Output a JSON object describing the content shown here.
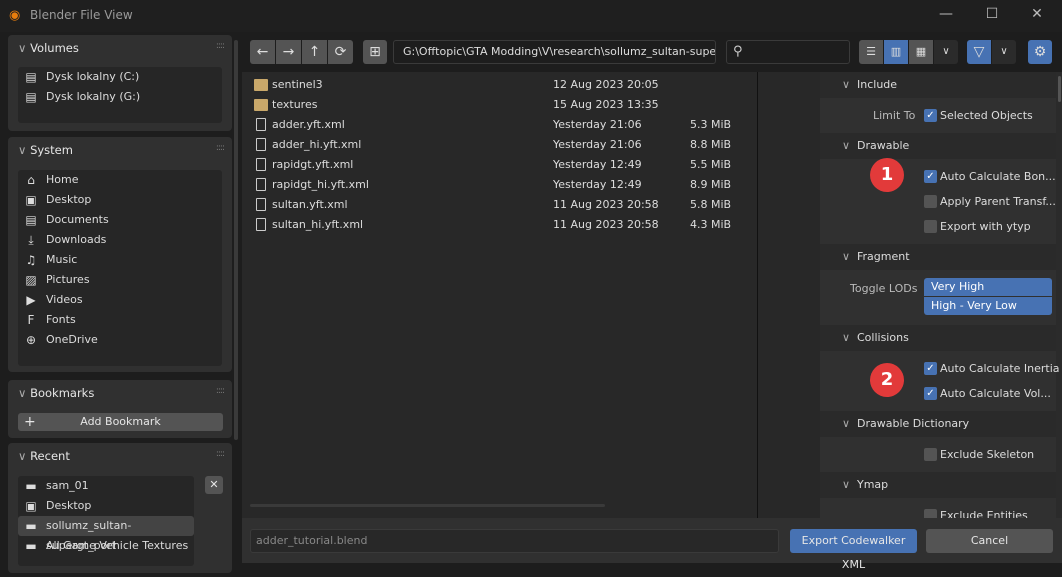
{
  "window": {
    "title": "Blender File View",
    "minimize": "—",
    "maximize": "☐",
    "close": "✕"
  },
  "sidebar": {
    "volumes": {
      "title": "Volumes",
      "items": [
        {
          "label": "Dysk lokalny (C:)",
          "icon": "drive-icon"
        },
        {
          "label": "Dysk lokalny (G:)",
          "icon": "drive-icon"
        }
      ]
    },
    "system": {
      "title": "System",
      "items": [
        {
          "label": "Home",
          "icon": "home-icon"
        },
        {
          "label": "Desktop",
          "icon": "desktop-icon"
        },
        {
          "label": "Documents",
          "icon": "documents-icon"
        },
        {
          "label": "Downloads",
          "icon": "downloads-icon"
        },
        {
          "label": "Music",
          "icon": "music-icon"
        },
        {
          "label": "Pictures",
          "icon": "pictures-icon"
        },
        {
          "label": "Videos",
          "icon": "videos-icon"
        },
        {
          "label": "Fonts",
          "icon": "fonts-icon"
        },
        {
          "label": "OneDrive",
          "icon": "onedrive-icon"
        }
      ]
    },
    "bookmarks": {
      "title": "Bookmarks",
      "add_label": "Add Bookmark"
    },
    "recent": {
      "title": "Recent",
      "items": [
        {
          "label": "sam_01",
          "icon": "folder-icon"
        },
        {
          "label": "Desktop",
          "icon": "desktop-icon"
        },
        {
          "label": "sollumz_sultan-supergt_port",
          "icon": "folder-icon",
          "selected": true
        },
        {
          "label": "All Game Vehicle Textures",
          "icon": "folder-icon"
        }
      ]
    }
  },
  "toolbar": {
    "path": "G:\\Offtopic\\GTA Modding\\V\\research\\sollumz_sultan-supergt...",
    "search_placeholder": "",
    "display_mode": "vertical-list"
  },
  "files": [
    {
      "name": "sentinel3",
      "date": "12 Aug 2023 20:05",
      "size": "",
      "type": "folder"
    },
    {
      "name": "textures",
      "date": "15 Aug 2023 13:35",
      "size": "",
      "type": "folder"
    },
    {
      "name": "adder.yft.xml",
      "date": "Yesterday 21:06",
      "size": "5.3 MiB",
      "type": "file"
    },
    {
      "name": "adder_hi.yft.xml",
      "date": "Yesterday 21:06",
      "size": "8.8 MiB",
      "type": "file"
    },
    {
      "name": "rapidgt.yft.xml",
      "date": "Yesterday 12:49",
      "size": "5.5 MiB",
      "type": "file"
    },
    {
      "name": "rapidgt_hi.yft.xml",
      "date": "Yesterday 12:49",
      "size": "8.9 MiB",
      "type": "file"
    },
    {
      "name": "sultan.yft.xml",
      "date": "11 Aug 2023 20:58",
      "size": "5.8 MiB",
      "type": "file"
    },
    {
      "name": "sultan_hi.yft.xml",
      "date": "11 Aug 2023 20:58",
      "size": "4.3 MiB",
      "type": "file"
    }
  ],
  "props": {
    "include": {
      "title": "Include",
      "limit_label": "Limit To",
      "selected_objects": {
        "label": "Selected Objects",
        "checked": true
      }
    },
    "drawable": {
      "title": "Drawable",
      "items": [
        {
          "label": "Auto Calculate Bon...",
          "checked": true
        },
        {
          "label": "Apply Parent Transf...",
          "checked": false
        },
        {
          "label": "Export with ytyp",
          "checked": false
        }
      ]
    },
    "fragment": {
      "title": "Fragment",
      "toggle_label": "Toggle LODs",
      "options": [
        "Very High",
        "High - Very Low"
      ]
    },
    "collisions": {
      "title": "Collisions",
      "items": [
        {
          "label": "Auto Calculate Inertia",
          "checked": true
        },
        {
          "label": "Auto Calculate Vol...",
          "checked": true
        }
      ]
    },
    "drawable_dictionary": {
      "title": "Drawable Dictionary",
      "items": [
        {
          "label": "Exclude Skeleton",
          "checked": false
        }
      ]
    },
    "ymap": {
      "title": "Ymap",
      "items": [
        {
          "label": "Exclude Entities",
          "checked": false
        }
      ]
    }
  },
  "badges": [
    "1",
    "2"
  ],
  "footer": {
    "filename": "adder_tutorial.blend",
    "export_label": "Export Codewalker XML",
    "cancel_label": "Cancel"
  },
  "colors": {
    "accent": "#4772b3",
    "badge": "#e23a3a",
    "folder": "#c9a86a"
  }
}
